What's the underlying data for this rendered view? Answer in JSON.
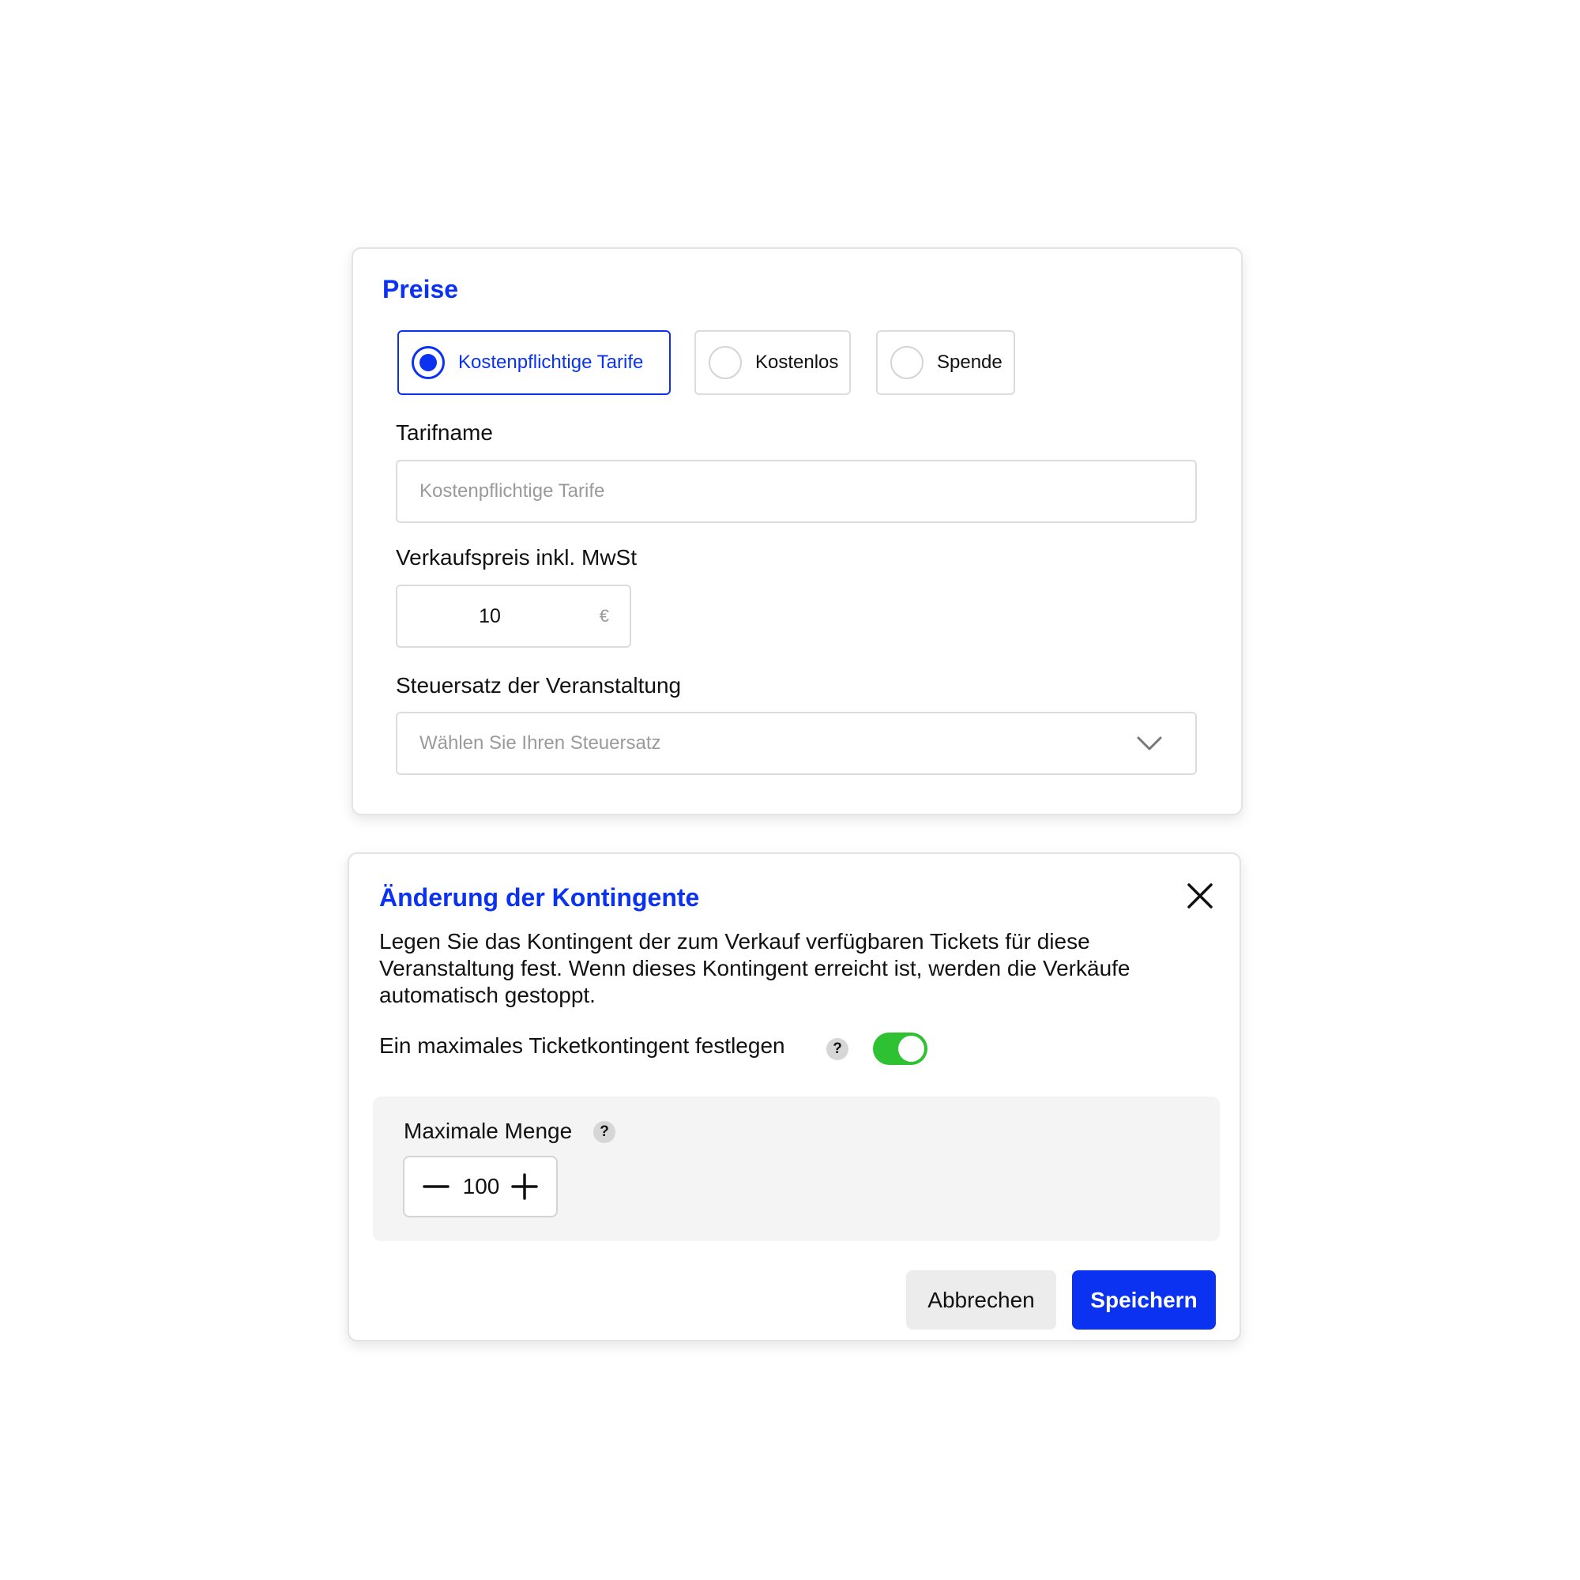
{
  "colors": {
    "accent": "#0a32f0",
    "toggle_on": "#2ec232",
    "panel_bg": "#f4f4f4",
    "border": "#dcdcdc"
  },
  "pricing": {
    "title": "Preise",
    "options": [
      {
        "label": "Kostenpflichtige Tarife",
        "selected": true
      },
      {
        "label": "Kostenlos",
        "selected": false
      },
      {
        "label": "Spende",
        "selected": false
      }
    ],
    "tariff_name": {
      "label": "Tarifname",
      "value": "",
      "placeholder": "Kostenpflichtige Tarife"
    },
    "price": {
      "label": "Verkaufspreis inkl. MwSt",
      "value": "10",
      "unit": "€"
    },
    "tax": {
      "label": "Steuersatz der Veranstaltung",
      "placeholder": "Wählen Sie Ihren Steuersatz",
      "icon": "chevron-down-icon"
    }
  },
  "quota": {
    "title": "Änderung der Kontingente",
    "close_icon": "close-icon",
    "description": "Legen Sie das Kontingent der zum Verkauf verfügbaren Tickets für diese Veranstaltung fest. Wenn dieses Kontingent erreicht ist, werden die Verkäufe automatisch gestoppt.",
    "toggle": {
      "label": "Ein maximales Ticketkontingent festlegen",
      "help": "?",
      "on": true
    },
    "max_quantity": {
      "label": "Maximale Menge",
      "help": "?",
      "value": "100",
      "decrement_icon": "minus-icon",
      "increment_icon": "plus-icon"
    },
    "cancel_label": "Abbrechen",
    "save_label": "Speichern"
  }
}
